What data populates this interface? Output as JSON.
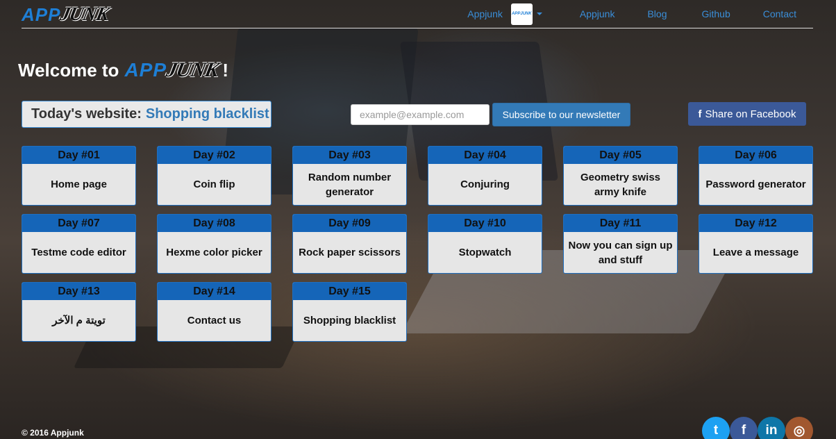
{
  "brand": {
    "logo_app": "APP",
    "logo_junk": "JUNK"
  },
  "nav": {
    "dropdown_label": "Appjunk",
    "avatar_text": "APPJUNK",
    "links": [
      "Appjunk",
      "Blog",
      "Github",
      "Contact"
    ]
  },
  "welcome": {
    "prefix": "Welcome to",
    "suffix": "!"
  },
  "today": {
    "label": "Today's website:",
    "site": "Shopping blacklist"
  },
  "newsletter": {
    "placeholder": "example@example.com",
    "button": "Subscribe to our newsletter"
  },
  "share": {
    "icon": "f",
    "label": "Share on Facebook"
  },
  "days": [
    {
      "day": "Day #01",
      "title": "Home page"
    },
    {
      "day": "Day #02",
      "title": "Coin flip"
    },
    {
      "day": "Day #03",
      "title": "Random number generator"
    },
    {
      "day": "Day #04",
      "title": "Conjuring"
    },
    {
      "day": "Day #05",
      "title": "Geometry swiss army knife"
    },
    {
      "day": "Day #06",
      "title": "Password generator"
    },
    {
      "day": "Day #07",
      "title": "Testme code editor"
    },
    {
      "day": "Day #08",
      "title": "Hexme color picker"
    },
    {
      "day": "Day #09",
      "title": "Rock paper scissors"
    },
    {
      "day": "Day #10",
      "title": "Stopwatch"
    },
    {
      "day": "Day #11",
      "title": "Now you can sign up and stuff"
    },
    {
      "day": "Day #12",
      "title": "Leave a message"
    },
    {
      "day": "Day #13",
      "title": "تويتة م الآخر"
    },
    {
      "day": "Day #14",
      "title": "Contact us"
    },
    {
      "day": "Day #15",
      "title": "Shopping blacklist"
    }
  ],
  "footer": {
    "copyright": "© 2016 Appjunk"
  },
  "socials": [
    {
      "name": "twitter-icon",
      "glyph": "t",
      "color": "#1da1f2"
    },
    {
      "name": "facebook-icon",
      "glyph": "f",
      "color": "#3b5998"
    },
    {
      "name": "linkedin-icon",
      "glyph": "in",
      "color": "#0e76a8"
    },
    {
      "name": "instagram-icon",
      "glyph": "◎",
      "color": "#a1572f"
    }
  ]
}
